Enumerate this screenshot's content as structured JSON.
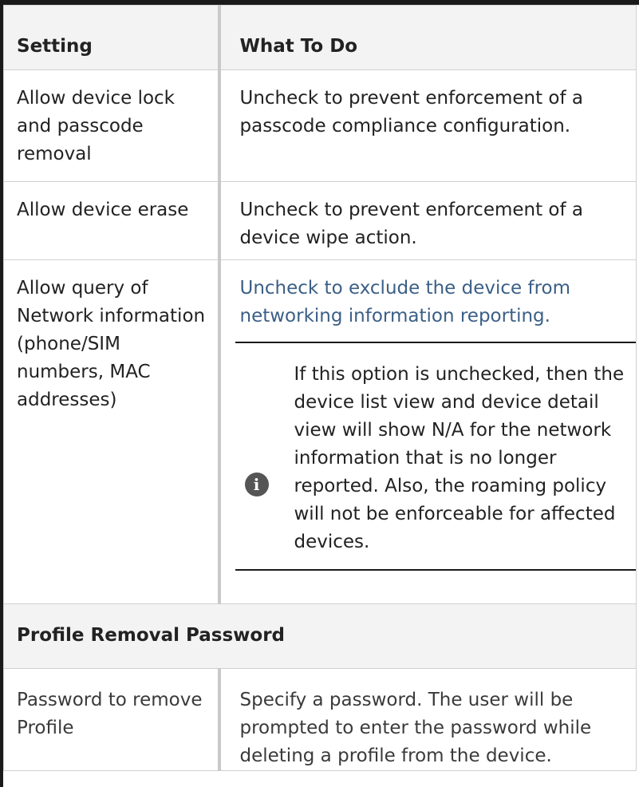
{
  "header": {
    "setting": "Setting",
    "what_to_do": "What To Do"
  },
  "rows": [
    {
      "setting": "Allow device lock and passcode removal",
      "action": "Uncheck to prevent enforcement of a passcode compliance configuration."
    },
    {
      "setting": "Allow device erase",
      "action": "Uncheck to prevent enforcement of a device wipe action."
    },
    {
      "setting": "Allow query of Network information (phone/SIM numbers, MAC addresses)",
      "action": "Uncheck to exclude the device from networking information reporting.",
      "note": "If this option is unchecked, then the device list view and device detail view will show N/A for the network information that is no longer reported. Also, the roaming policy will not be enforceable for affected devices.",
      "note_icon": "info-icon"
    }
  ],
  "section": {
    "title": "Profile Removal Password"
  },
  "password_row": {
    "setting": "Password to remove Profile",
    "action": "Specify a password. The user will be prompted to enter the password while deleting a profile from the device."
  }
}
